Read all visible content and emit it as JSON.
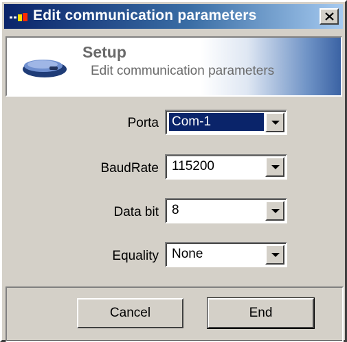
{
  "window": {
    "title": "Edit communication parameters"
  },
  "header": {
    "title": "Setup",
    "subtitle": "Edit communication parameters"
  },
  "fields": [
    {
      "label": "Porta",
      "value": "Com-1"
    },
    {
      "label": "BaudRate",
      "value": "115200"
    },
    {
      "label": "Data bit",
      "value": "8"
    },
    {
      "label": "Equality",
      "value": "None"
    }
  ],
  "buttons": {
    "cancel": "Cancel",
    "end": "End"
  },
  "icons": {
    "app": "network-plug-icon",
    "header": "modem-device-icon",
    "close": "close-icon",
    "dropdown": "chevron-down-icon"
  },
  "colors": {
    "titlebar": "#0a246a",
    "selection": "#0a246a",
    "face": "#d4d0c8"
  }
}
